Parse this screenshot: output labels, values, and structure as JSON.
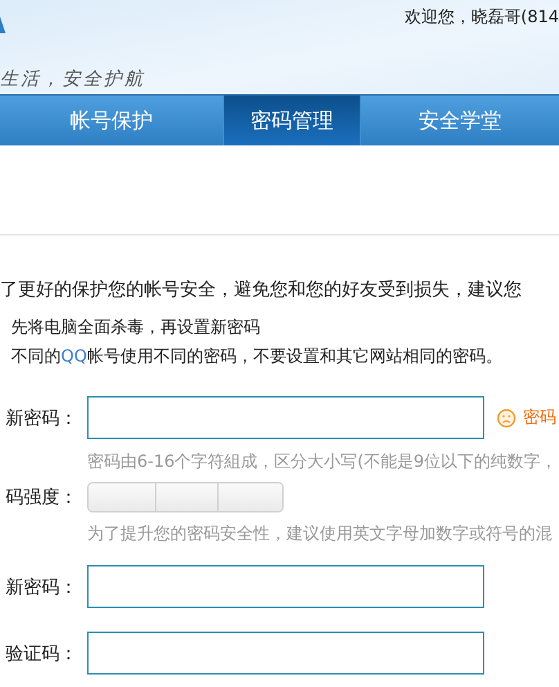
{
  "header": {
    "slogan": "生活，安全护航",
    "welcome": "欢迎您，晓磊哥(814"
  },
  "tabs": [
    {
      "label": "帐号保护",
      "selected": false
    },
    {
      "label": "密码管理",
      "selected": true
    },
    {
      "label": "安全学堂",
      "selected": false
    }
  ],
  "intro": "了更好的保护您的帐号安全，避免您和您的好友受到损失，建议您",
  "tips": [
    "先将电脑全面杀毒，再设置新密码",
    "不同的**QQ**帐号使用不同的密码，不要设置和其它网站相同的密码。"
  ],
  "form": [
    {
      "kind": "input",
      "label": "新密码：",
      "status": "密码"
    },
    {
      "kind": "hint",
      "text": "密码由6-16个字符組成，区分大小写(不能是9位以下的纯数字，"
    },
    {
      "kind": "strength",
      "label": "码强度："
    },
    {
      "kind": "hint",
      "text": "为了提升您的密码安全性，建议使用英文字母加数字或符号的混"
    },
    {
      "kind": "input",
      "label": "新密码："
    },
    {
      "kind": "input",
      "label": "验证码："
    }
  ]
}
